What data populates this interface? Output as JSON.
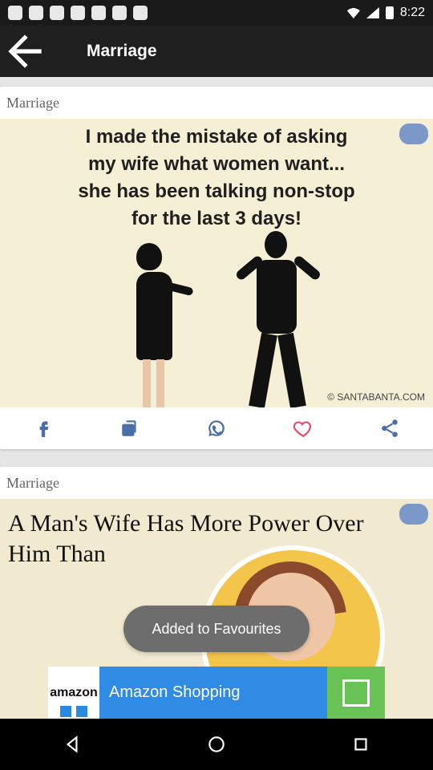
{
  "status": {
    "time": "8:22"
  },
  "app_bar": {
    "title": "Marriage"
  },
  "cards": [
    {
      "title": "Marriage",
      "joke_lines": [
        "I made the mistake of asking",
        "my wife what women want...",
        "she has been talking non-stop",
        "for the last 3 days!"
      ],
      "credit": "© SANTABANTA.COM"
    },
    {
      "title": "Marriage",
      "headline": "A Man's Wife Has More Power Over Him Than"
    }
  ],
  "toast": {
    "text": "Added to Favourites"
  },
  "ad": {
    "logo_text": "amazon",
    "text": "Amazon Shopping"
  },
  "colors": {
    "accent_heart": "#e84b6a",
    "icon_blue": "#4a6ea9"
  }
}
